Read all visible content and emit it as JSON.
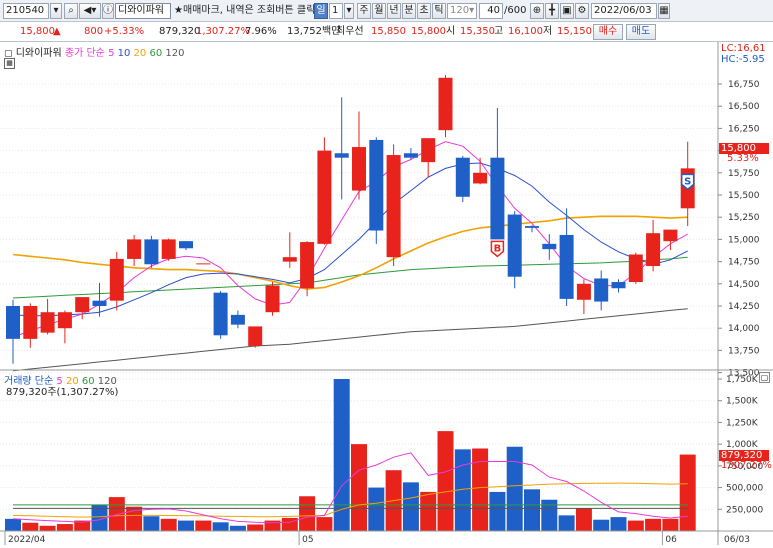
{
  "toolbar": {
    "code": "210540",
    "stock_name": "디와이파워",
    "hint": "매매마크, 내역은 조회버튼 클릭",
    "period_selected": "일",
    "period_value": "1",
    "periods": [
      "주",
      "월",
      "년",
      "분",
      "초",
      "틱"
    ],
    "tick_value": "120",
    "count": "40",
    "count_total": "/600",
    "date": "2022/06/03"
  },
  "quote": {
    "price": "15,800",
    "change": "800",
    "change_pct": "+5.33%",
    "volume": "879,320",
    "volume_ratio": "1,307.27%",
    "turnover": "7.96%",
    "amount": "13,752백만",
    "best_label": "최우선",
    "ask": "15,850",
    "bid": "15,800",
    "open_label": "시",
    "open": "15,350",
    "high_label": "고",
    "high": "16,100",
    "low_label": "저",
    "low": "15,150",
    "buy_label": "매수",
    "sell_label": "매도"
  },
  "price_panel": {
    "legend_name": "디와이파워",
    "legend_ma": "종가 단순",
    "ma_periods": [
      "5",
      "10",
      "20",
      "60",
      "120"
    ],
    "lc_label": "LC:16,61",
    "hc_label": "HC:-5.95",
    "current_price": "15,800",
    "current_pct": "5.33%",
    "marker_s": "S",
    "marker_b": "B"
  },
  "volume_panel": {
    "legend_name": "거래량",
    "legend_ma": "단순",
    "ma_periods": [
      "5",
      "20",
      "60",
      "120"
    ],
    "summary": "879,320주(1,307.27%)",
    "current_volume": "879,320",
    "current_pct": "1307.27%"
  },
  "chart_data": {
    "type": "candlestick",
    "price_axis_ticks": [
      "16,750",
      "16,500",
      "16,250",
      "16,000",
      "15,750",
      "15,500",
      "15,250",
      "15,000",
      "14,750",
      "14,500",
      "14,250",
      "14,000",
      "13,750",
      "13,500"
    ],
    "volume_axis_ticks": [
      "1,750K",
      "1,500K",
      "1,250K",
      "1,000K",
      "750,000",
      "500,000",
      "250,000"
    ],
    "x_labels": [
      {
        "text": "2022/04",
        "index": 0
      },
      {
        "text": "05",
        "index": 17
      },
      {
        "text": "06",
        "index": 38
      },
      {
        "text": "06/03",
        "index": 40
      }
    ],
    "candles": [
      {
        "o": 14250,
        "h": 14320,
        "l": 13600,
        "c": 13880
      },
      {
        "o": 13880,
        "h": 14280,
        "l": 13780,
        "c": 14250
      },
      {
        "o": 13950,
        "h": 14330,
        "l": 13930,
        "c": 14180
      },
      {
        "o": 14000,
        "h": 14200,
        "l": 13830,
        "c": 14180
      },
      {
        "o": 14180,
        "h": 14350,
        "l": 14100,
        "c": 14350
      },
      {
        "o": 14310,
        "h": 14510,
        "l": 14130,
        "c": 14250
      },
      {
        "o": 14310,
        "h": 14860,
        "l": 14200,
        "c": 14780
      },
      {
        "o": 14780,
        "h": 15050,
        "l": 14700,
        "c": 15000
      },
      {
        "o": 15000,
        "h": 15040,
        "l": 14680,
        "c": 14720
      },
      {
        "o": 14780,
        "h": 15010,
        "l": 14760,
        "c": 15000
      },
      {
        "o": 14980,
        "h": 14980,
        "l": 14880,
        "c": 14900
      },
      {
        "o": 14730,
        "h": 14730,
        "l": 14730,
        "c": 14730
      },
      {
        "o": 14400,
        "h": 14420,
        "l": 13880,
        "c": 13920
      },
      {
        "o": 14150,
        "h": 14200,
        "l": 14000,
        "c": 14040
      },
      {
        "o": 13800,
        "h": 14000,
        "l": 13780,
        "c": 14020
      },
      {
        "o": 14180,
        "h": 14520,
        "l": 14140,
        "c": 14480
      },
      {
        "o": 14750,
        "h": 15080,
        "l": 14680,
        "c": 14800
      },
      {
        "o": 14450,
        "h": 14980,
        "l": 14360,
        "c": 14970
      },
      {
        "o": 14950,
        "h": 16150,
        "l": 14940,
        "c": 16000
      },
      {
        "o": 15970,
        "h": 16600,
        "l": 15450,
        "c": 15920
      },
      {
        "o": 15550,
        "h": 16440,
        "l": 15450,
        "c": 16040
      },
      {
        "o": 16120,
        "h": 16150,
        "l": 14950,
        "c": 15100
      },
      {
        "o": 14800,
        "h": 16070,
        "l": 14700,
        "c": 15950
      },
      {
        "o": 15970,
        "h": 16030,
        "l": 15900,
        "c": 15920
      },
      {
        "o": 15870,
        "h": 16100,
        "l": 15700,
        "c": 16140
      },
      {
        "o": 16230,
        "h": 16850,
        "l": 16150,
        "c": 16820
      },
      {
        "o": 15920,
        "h": 15940,
        "l": 15420,
        "c": 15480
      },
      {
        "o": 15630,
        "h": 15920,
        "l": 15620,
        "c": 15750
      },
      {
        "o": 15920,
        "h": 16480,
        "l": 15000,
        "c": 15000
      },
      {
        "o": 15280,
        "h": 15320,
        "l": 14450,
        "c": 14580
      },
      {
        "o": 15150,
        "h": 15160,
        "l": 15080,
        "c": 15130
      },
      {
        "o": 14950,
        "h": 15060,
        "l": 14770,
        "c": 14890
      },
      {
        "o": 15050,
        "h": 15350,
        "l": 14250,
        "c": 14330
      },
      {
        "o": 14320,
        "h": 14550,
        "l": 14160,
        "c": 14500
      },
      {
        "o": 14560,
        "h": 14650,
        "l": 14200,
        "c": 14300
      },
      {
        "o": 14520,
        "h": 14550,
        "l": 14400,
        "c": 14450
      },
      {
        "o": 14520,
        "h": 14850,
        "l": 14500,
        "c": 14830
      },
      {
        "o": 14700,
        "h": 15220,
        "l": 14640,
        "c": 15070
      },
      {
        "o": 14980,
        "h": 15080,
        "l": 14880,
        "c": 15110
      },
      {
        "o": 15350,
        "h": 16100,
        "l": 15150,
        "c": 15800
      }
    ],
    "volume_k": [
      140,
      95,
      60,
      80,
      120,
      300,
      390,
      280,
      170,
      140,
      120,
      120,
      100,
      60,
      75,
      120,
      150,
      400,
      160,
      1750,
      1000,
      500,
      700,
      560,
      450,
      1150,
      940,
      950,
      450,
      970,
      480,
      360,
      180,
      260,
      130,
      160,
      120,
      140,
      140,
      880
    ],
    "moving_averages": {
      "ma5": [
        13900,
        13970,
        14040,
        14100,
        14160,
        14270,
        14400,
        14570,
        14700,
        14780,
        14810,
        14790,
        14680,
        14480,
        14330,
        14260,
        14290,
        14560,
        14900,
        15220,
        15540,
        15650,
        15820,
        15900,
        16010,
        16100,
        16050,
        15880,
        15600,
        15350,
        15180,
        14950,
        14700,
        14560,
        14480,
        14480,
        14620,
        14800,
        14950,
        15060
      ],
      "ma10": [
        14150,
        14140,
        14140,
        14150,
        14160,
        14180,
        14240,
        14320,
        14400,
        14490,
        14570,
        14610,
        14620,
        14610,
        14580,
        14550,
        14510,
        14560,
        14660,
        14830,
        15000,
        15200,
        15400,
        15550,
        15700,
        15800,
        15850,
        15860,
        15800,
        15720,
        15600,
        15420,
        15270,
        15110,
        14970,
        14860,
        14780,
        14720,
        14770,
        14870
      ],
      "ma20": [
        14830,
        14810,
        14790,
        14770,
        14740,
        14720,
        14700,
        14680,
        14670,
        14660,
        14660,
        14650,
        14640,
        14610,
        14570,
        14530,
        14480,
        14440,
        14460,
        14520,
        14590,
        14680,
        14780,
        14870,
        14960,
        15030,
        15090,
        15130,
        15150,
        15170,
        15190,
        15210,
        15240,
        15250,
        15260,
        15260,
        15260,
        15250,
        15240,
        15250
      ],
      "ma60": [
        14340,
        14350,
        14360,
        14370,
        14380,
        14390,
        14400,
        14410,
        14420,
        14430,
        14440,
        14450,
        14460,
        14470,
        14480,
        14490,
        14500,
        14510,
        14540,
        14570,
        14600,
        14620,
        14640,
        14660,
        14670,
        14680,
        14690,
        14700,
        14705,
        14710,
        14715,
        14720,
        14725,
        14730,
        14735,
        14745,
        14755,
        14770,
        14780,
        14800
      ],
      "ma120": [
        13520,
        13540,
        13560,
        13580,
        13600,
        13620,
        13640,
        13660,
        13680,
        13700,
        13720,
        13740,
        13760,
        13780,
        13800,
        13810,
        13820,
        13840,
        13860,
        13880,
        13900,
        13920,
        13940,
        13960,
        13970,
        13980,
        13990,
        14000,
        14010,
        14020,
        14040,
        14060,
        14080,
        14100,
        14120,
        14140,
        14160,
        14180,
        14200,
        14220
      ]
    },
    "volume_moving_averages": {
      "vma5": [
        140,
        130,
        120,
        110,
        100,
        130,
        190,
        235,
        250,
        255,
        230,
        185,
        140,
        110,
        100,
        95,
        100,
        160,
        180,
        520,
        700,
        760,
        850,
        900,
        640,
        680,
        760,
        800,
        800,
        800,
        760,
        620,
        570,
        460,
        330,
        220,
        200,
        170,
        150,
        170
      ],
      "vma20": [
        180,
        175,
        170,
        165,
        160,
        165,
        175,
        180,
        180,
        178,
        175,
        175,
        170,
        168,
        165,
        165,
        168,
        175,
        178,
        250,
        300,
        320,
        350,
        380,
        420,
        450,
        480,
        500,
        510,
        520,
        530,
        540,
        545,
        548,
        550,
        552,
        550,
        545,
        540,
        545
      ],
      "vma60": [
        300,
        300,
        300,
        300,
        300,
        300,
        300,
        300,
        300,
        300,
        300,
        300,
        300,
        300,
        300,
        300,
        300,
        300,
        300,
        300,
        300,
        300,
        300,
        300,
        300,
        300,
        300,
        300,
        300,
        300,
        300,
        300,
        300,
        300,
        300,
        300,
        300,
        300,
        300,
        300
      ],
      "vma120": [
        260,
        260,
        260,
        260,
        260,
        260,
        260,
        260,
        260,
        260,
        260,
        260,
        260,
        260,
        260,
        260,
        260,
        260,
        260,
        260,
        260,
        260,
        260,
        260,
        260,
        260,
        260,
        260,
        260,
        260,
        260,
        260,
        260,
        260,
        260,
        260,
        260,
        260,
        260,
        260
      ]
    },
    "markers": [
      {
        "text": "B",
        "index": 28,
        "type": "buy"
      },
      {
        "text": "S",
        "index": 39,
        "type": "sell"
      }
    ],
    "colors": {
      "up": "#e8231b",
      "down": "#1f5fc8",
      "ma5": "#e83ad8",
      "ma10": "#2b4fd0",
      "ma20": "#f0a202",
      "ma60": "#2e9b3a",
      "ma120": "#555555"
    }
  }
}
